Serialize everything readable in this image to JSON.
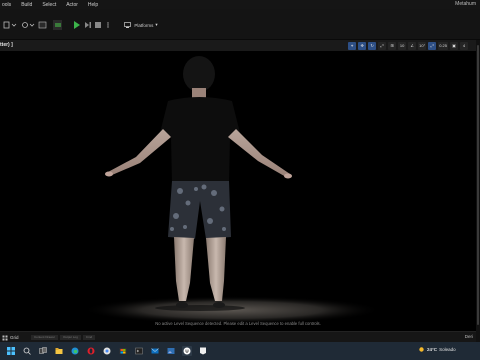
{
  "menubar": {
    "items": [
      "ools",
      "Build",
      "Select",
      "Actor",
      "Help"
    ],
    "title": "Metahum"
  },
  "toolbar": {
    "platforms_label": "Platforms",
    "mode_glyph": "▾"
  },
  "viewport": {
    "title": "tter) ]",
    "tools": [
      {
        "label": "⌖",
        "icon": "select-icon",
        "active": true
      },
      {
        "label": "✥",
        "icon": "move-icon",
        "active": true
      },
      {
        "label": "↻",
        "icon": "rotate-icon",
        "active": true
      },
      {
        "label": "⤢",
        "icon": "scale-icon",
        "active": false
      },
      {
        "label": "⊞",
        "icon": "grid-snap-icon",
        "active": false
      },
      {
        "label": "10",
        "icon": "grid-value",
        "active": false
      },
      {
        "label": "∠",
        "icon": "angle-snap-icon",
        "active": false
      },
      {
        "label": "10°",
        "icon": "angle-value",
        "active": false
      },
      {
        "label": "⤢",
        "icon": "scale-snap-icon",
        "active": true
      },
      {
        "label": "0.25",
        "icon": "scale-value",
        "active": false
      },
      {
        "label": "▣",
        "icon": "camera-speed-icon",
        "active": false
      },
      {
        "label": "4",
        "icon": "camera-speed-value",
        "active": false
      }
    ],
    "notice": "No active Level Sequence detected. Please edit a Level Sequence to enable full controls."
  },
  "bottombar": {
    "grid_label": "Grid",
    "tabs": [
      "Content Drawer",
      "Output Log",
      "Cmd"
    ],
    "right_label": "Deri"
  },
  "taskbar": {
    "temperature": "24°C",
    "weather": "Soleado",
    "icons": [
      "windows-icon",
      "search-icon",
      "task-view-icon",
      "file-explorer-icon",
      "edge-icon",
      "opera-icon",
      "chrome-icon",
      "store-icon",
      "terminal-icon",
      "mail-icon",
      "photos-icon",
      "unreal-engine-icon",
      "epic-games-icon"
    ]
  }
}
